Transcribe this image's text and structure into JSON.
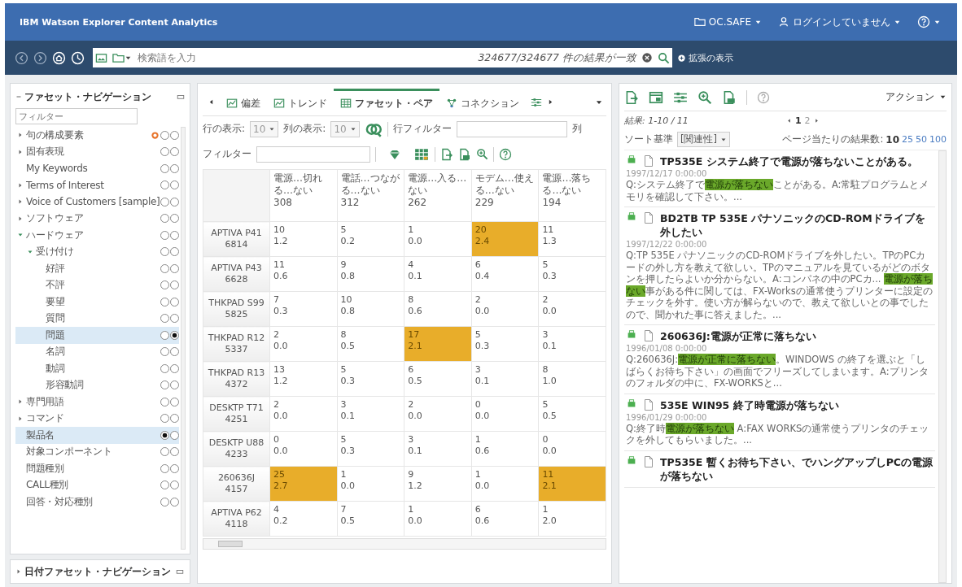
{
  "header": {
    "title": "IBM Watson Explorer Content Analytics",
    "collection": "OC.SAFE",
    "login": "ログインしていません"
  },
  "search": {
    "placeholder": "検索語を入力",
    "result_count": "324677/324677 件の結果が一致",
    "advanced_link": "拡張の表示"
  },
  "facet_navigation": {
    "title": "ファセット・ナビゲーション",
    "filter_placeholder": "フィルター",
    "items": [
      {
        "label": "句の構成要素",
        "kind": "group",
        "expanded": false,
        "badge": true,
        "as_row": false,
        "as_column": false
      },
      {
        "label": "固有表現",
        "kind": "group",
        "expanded": false,
        "as_row": false,
        "as_column": false
      },
      {
        "label": "My Keywords",
        "kind": "leaf",
        "as_row": false,
        "as_column": false
      },
      {
        "label": "Terms of Interest",
        "kind": "group",
        "expanded": false,
        "as_row": false,
        "as_column": false
      },
      {
        "label": "Voice of Customers [sample]",
        "kind": "group",
        "expanded": false,
        "as_row": false,
        "as_column": false
      },
      {
        "label": "ソフトウェア",
        "kind": "group",
        "expanded": false,
        "as_row": false,
        "as_column": false
      },
      {
        "label": "ハードウェア",
        "kind": "group",
        "expanded": true,
        "as_row": false,
        "as_column": false,
        "children": [
          {
            "label": "受け付け",
            "kind": "group",
            "expanded": true,
            "as_row": false,
            "as_column": false,
            "children": [
              {
                "label": "好評",
                "kind": "leaf",
                "as_row": false,
                "as_column": false
              },
              {
                "label": "不評",
                "kind": "leaf",
                "as_row": false,
                "as_column": false
              },
              {
                "label": "要望",
                "kind": "leaf",
                "as_row": false,
                "as_column": false
              },
              {
                "label": "質問",
                "kind": "leaf",
                "as_row": false,
                "as_column": false
              },
              {
                "label": "問題",
                "kind": "leaf",
                "as_row": false,
                "as_column": true
              },
              {
                "label": "名詞",
                "kind": "leaf",
                "as_row": false,
                "as_column": false
              },
              {
                "label": "動詞",
                "kind": "leaf",
                "as_row": false,
                "as_column": false
              },
              {
                "label": "形容動詞",
                "kind": "leaf",
                "as_row": false,
                "as_column": false
              }
            ]
          }
        ]
      },
      {
        "label": "専門用語",
        "kind": "group",
        "expanded": false,
        "as_row": false,
        "as_column": false
      },
      {
        "label": "コマンド",
        "kind": "group",
        "expanded": false,
        "as_row": false,
        "as_column": false
      },
      {
        "label": "製品名",
        "kind": "leaf",
        "as_row": true,
        "as_column": false
      },
      {
        "label": "対象コンポーネント",
        "kind": "leaf",
        "as_row": false,
        "as_column": false
      },
      {
        "label": "問題種別",
        "kind": "leaf",
        "as_row": false,
        "as_column": false
      },
      {
        "label": "CALL種別",
        "kind": "leaf",
        "as_row": false,
        "as_column": false
      },
      {
        "label": "回答・対応種別",
        "kind": "leaf",
        "as_row": false,
        "as_column": false
      }
    ]
  },
  "date_facet_navigation": {
    "title": "日付ファセット・ナビゲーション",
    "expanded": false
  },
  "tabs": [
    {
      "label": "偏差",
      "selected": false
    },
    {
      "label": "トレンド",
      "selected": false
    },
    {
      "label": "ファセット・ペア",
      "selected": true
    },
    {
      "label": "コネクション",
      "selected": false
    }
  ],
  "pair_toolbar": {
    "rows_label": "行の表示:",
    "rows_value": "10",
    "columns_label": "列の表示:",
    "columns_value": "10",
    "row_filter_label": "行フィルター",
    "column_filter_label": "列",
    "filter_label": "フィルター"
  },
  "table": {
    "columns": [
      {
        "label": "電源…切れる…ない",
        "count": "308"
      },
      {
        "label": "電話…つながる…ない",
        "count": "312"
      },
      {
        "label": "電源…入る…ない",
        "count": "262"
      },
      {
        "label": "モデム…使える…ない",
        "count": "229"
      },
      {
        "label": "電源…落ちる…ない",
        "count": "194"
      }
    ],
    "rows": [
      {
        "label": "APTIVA P41",
        "count": "6814",
        "cells": [
          {
            "count": "10",
            "ratio": "1.2",
            "highlight": false
          },
          {
            "count": "5",
            "ratio": "0.2",
            "highlight": false
          },
          {
            "count": "1",
            "ratio": "0.0",
            "highlight": false
          },
          {
            "count": "20",
            "ratio": "2.4",
            "highlight": true
          },
          {
            "count": "11",
            "ratio": "1.3",
            "highlight": false
          }
        ]
      },
      {
        "label": "APTIVA P43",
        "count": "6628",
        "cells": [
          {
            "count": "11",
            "ratio": "0.6",
            "highlight": false
          },
          {
            "count": "9",
            "ratio": "0.8",
            "highlight": false
          },
          {
            "count": "4",
            "ratio": "0.1",
            "highlight": false
          },
          {
            "count": "6",
            "ratio": "0.4",
            "highlight": false
          },
          {
            "count": "5",
            "ratio": "0.3",
            "highlight": false
          }
        ]
      },
      {
        "label": "THKPAD S99",
        "count": "5825",
        "cells": [
          {
            "count": "7",
            "ratio": "0.3",
            "highlight": false
          },
          {
            "count": "10",
            "ratio": "0.8",
            "highlight": false
          },
          {
            "count": "8",
            "ratio": "0.6",
            "highlight": false
          },
          {
            "count": "2",
            "ratio": "0.0",
            "highlight": false
          },
          {
            "count": "2",
            "ratio": "0.0",
            "highlight": false
          }
        ]
      },
      {
        "label": "THKPAD R12",
        "count": "5337",
        "cells": [
          {
            "count": "2",
            "ratio": "0.0",
            "highlight": false
          },
          {
            "count": "8",
            "ratio": "0.5",
            "highlight": false
          },
          {
            "count": "17",
            "ratio": "2.1",
            "highlight": true
          },
          {
            "count": "5",
            "ratio": "0.3",
            "highlight": false
          },
          {
            "count": "3",
            "ratio": "0.1",
            "highlight": false
          }
        ]
      },
      {
        "label": "THKPAD R13",
        "count": "4372",
        "cells": [
          {
            "count": "13",
            "ratio": "1.2",
            "highlight": false
          },
          {
            "count": "5",
            "ratio": "0.3",
            "highlight": false
          },
          {
            "count": "6",
            "ratio": "0.5",
            "highlight": false
          },
          {
            "count": "3",
            "ratio": "0.1",
            "highlight": false
          },
          {
            "count": "8",
            "ratio": "1.0",
            "highlight": false
          }
        ]
      },
      {
        "label": "DESKTP T71",
        "count": "4251",
        "cells": [
          {
            "count": "2",
            "ratio": "0.0",
            "highlight": false
          },
          {
            "count": "3",
            "ratio": "0.1",
            "highlight": false
          },
          {
            "count": "2",
            "ratio": "0.0",
            "highlight": false
          },
          {
            "count": "0",
            "ratio": "0.0",
            "highlight": false
          },
          {
            "count": "5",
            "ratio": "0.5",
            "highlight": false
          }
        ]
      },
      {
        "label": "DESKTP U88",
        "count": "4233",
        "cells": [
          {
            "count": "0",
            "ratio": "0.0",
            "highlight": false
          },
          {
            "count": "5",
            "ratio": "0.3",
            "highlight": false
          },
          {
            "count": "3",
            "ratio": "0.1",
            "highlight": false
          },
          {
            "count": "1",
            "ratio": "0.6",
            "highlight": false
          },
          {
            "count": "0",
            "ratio": "0.0",
            "highlight": false
          }
        ]
      },
      {
        "label": "260636J",
        "count": "4157",
        "cells": [
          {
            "count": "25",
            "ratio": "2.7",
            "highlight": true
          },
          {
            "count": "1",
            "ratio": "0.0",
            "highlight": false
          },
          {
            "count": "9",
            "ratio": "1.2",
            "highlight": false
          },
          {
            "count": "1",
            "ratio": "0.0",
            "highlight": false
          },
          {
            "count": "11",
            "ratio": "2.1",
            "highlight": true
          }
        ]
      },
      {
        "label": "APTIVA P62",
        "count": "4118",
        "cells": [
          {
            "count": "4",
            "ratio": "0.2",
            "highlight": false
          },
          {
            "count": "7",
            "ratio": "0.5",
            "highlight": false
          },
          {
            "count": "1",
            "ratio": "0.0",
            "highlight": false
          },
          {
            "count": "6",
            "ratio": "0.6",
            "highlight": false
          },
          {
            "count": "1",
            "ratio": "2.0",
            "highlight": false
          }
        ]
      }
    ]
  },
  "results": {
    "action_menu": "アクション",
    "range": "結果: 1-10 / 11",
    "pages": [
      {
        "label": "1",
        "selected": true
      },
      {
        "label": "2",
        "selected": false
      }
    ],
    "sort_label": "ソート基準",
    "sort_value": "[関連性]",
    "per_page_label": "ページ当たりの結果数:",
    "per_page": [
      {
        "label": "10",
        "selected": true
      },
      {
        "label": "25",
        "selected": false
      },
      {
        "label": "50",
        "selected": false
      },
      {
        "label": "100",
        "selected": false
      }
    ],
    "items": [
      {
        "title": "TP535E システム終了で電源が落ちないことがある。",
        "date": "1997/12/17 0:00:00",
        "snippet": "Q:システム終了で**電源が落ちない**ことがある。A:常駐プログラムとメモリを確認して下さい。..."
      },
      {
        "title": "BD2TB TP 535E パナソニックのCD-ROMドライブを外したい",
        "date": "1997/12/22 0:00:00",
        "snippet": "Q:TP 535E パナソニックのCD-ROMドライブを外したい。TPのPCカードの外し方を教えて欲しい。TPのマニュアルを見ているがどのボタンを押したらよいか分からない。A:コンパネの中のPCカ... **電源が落ちない**事がある件に関しては、FX-Worksの通常使うプリンターに設定のチェックを外す。使い方が解らないので、教えて欲しいとの事でしたので、聞かれた事に答えました。..."
      },
      {
        "title": "260636J:電源が正常に落ちない",
        "date": "1996/01/08 0:00:00",
        "snippet": "Q:260636J:**電源が正常に落ちない**。WINDOWS の終了を選ぶと「しばらくお待ち下さい」の画面でフリーズしてしまいます。A:プリンタのフォルダの中に、FX-WORKSと..."
      },
      {
        "title": "535E WIN95 終了時電源が落ちない",
        "date": "1996/01/29 0:00:00",
        "snippet": "Q:終了時**電源が落ちない** A:FAX WORKSの通常使うプリンタのチェックを外してもらいました。..."
      },
      {
        "title": "TP535E 暫くお待ち下さい、でハングアップしPCの電源が落ちない"
      }
    ]
  }
}
